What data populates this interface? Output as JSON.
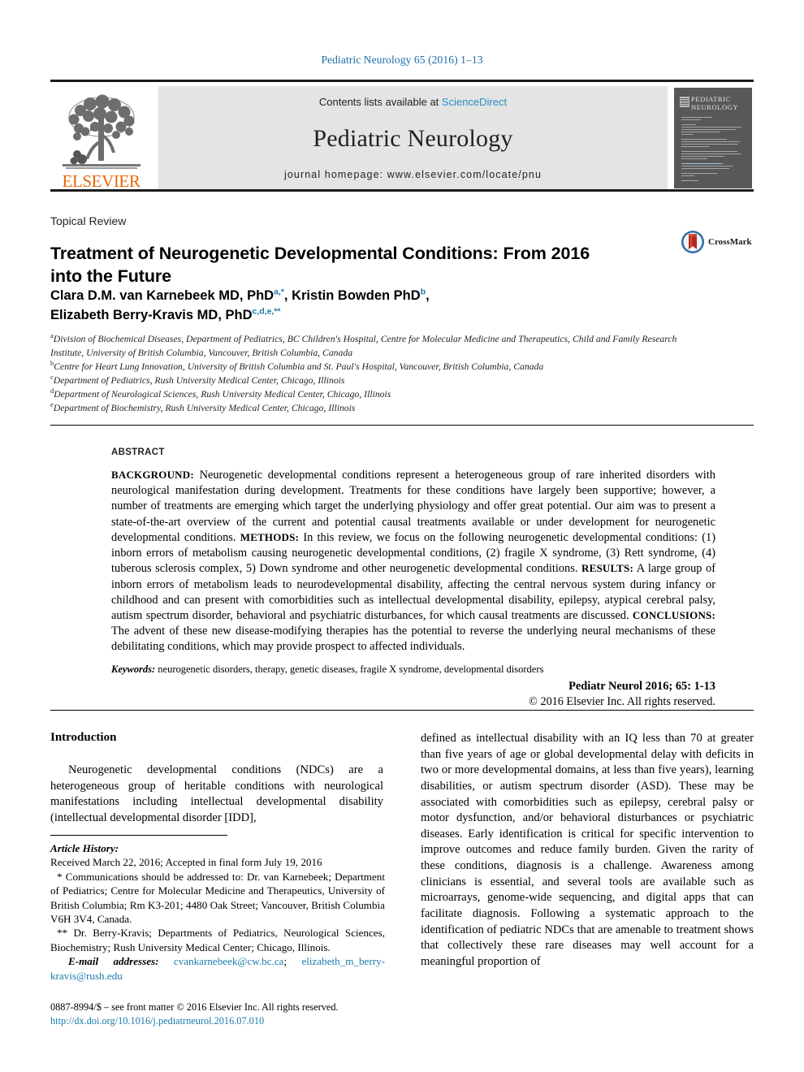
{
  "running_head": "Pediatric Neurology 65 (2016) 1–13",
  "masthead": {
    "contents_prefix": "Contents lists available at ",
    "sciencedirect": "ScienceDirect",
    "journal_name": "Pediatric Neurology",
    "homepage": "journal homepage: www.elsevier.com/locate/pnu",
    "publisher": "ELSEVIER",
    "cover_title_line1": "PEDIATRIC",
    "cover_title_line2": "NEUROLOGY"
  },
  "article": {
    "type_label": "Topical Review",
    "title": "Treatment of Neurogenetic Developmental Conditions: From 2016 into the Future",
    "crossmark_label": "CrossMark",
    "authors_line1_name1": "Clara D.M. van Karnebeek MD, PhD",
    "authors_line1_sup1": "a,*",
    "authors_line1_sep1": ", ",
    "authors_line1_name2": "Kristin Bowden PhD",
    "authors_line1_sup2": "b",
    "authors_line1_end": ",",
    "authors_line2_name": "Elizabeth Berry-Kravis MD, PhD",
    "authors_line2_sup": "c,d,e,**",
    "affiliations": [
      {
        "mark": "a",
        "text": "Division of Biochemical Diseases, Department of Pediatrics, BC Children's Hospital, Centre for Molecular Medicine and Therapeutics, Child and Family Research Institute, University of British Columbia, Vancouver, British Columbia, Canada"
      },
      {
        "mark": "b",
        "text": "Centre for Heart Lung Innovation, University of British Columbia and St. Paul's Hospital, Vancouver, British Columbia, Canada"
      },
      {
        "mark": "c",
        "text": "Department of Pediatrics, Rush University Medical Center, Chicago, Illinois"
      },
      {
        "mark": "d",
        "text": "Department of Neurological Sciences, Rush University Medical Center, Chicago, Illinois"
      },
      {
        "mark": "e",
        "text": "Department of Biochemistry, Rush University Medical Center, Chicago, Illinois"
      }
    ]
  },
  "abstract": {
    "label": "ABSTRACT",
    "sections": [
      {
        "head": "BACKGROUND:",
        "text": " Neurogenetic developmental conditions represent a heterogeneous group of rare inherited disorders with neurological manifestation during development. Treatments for these conditions have largely been supportive; however, a number of treatments are emerging which target the underlying physiology and offer great potential. Our aim was to present a state-of-the-art overview of the current and potential causal treatments available or under development for neurogenetic developmental conditions. "
      },
      {
        "head": "METHODS:",
        "text": " In this review, we focus on the following neurogenetic developmental conditions: (1) inborn errors of metabolism causing neurogenetic developmental conditions, (2) fragile X syndrome, (3) Rett syndrome, (4) tuberous sclerosis complex, 5) Down syndrome and other neurogenetic developmental conditions. "
      },
      {
        "head": "RESULTS:",
        "text": " A large group of inborn errors of metabolism leads to neurodevelopmental disability, affecting the central nervous system during infancy or childhood and can present with comorbidities such as intellectual developmental disability, epilepsy, atypical cerebral palsy, autism spectrum disorder, behavioral and psychiatric disturbances, for which causal treatments are discussed. "
      },
      {
        "head": "CONCLUSIONS:",
        "text": " The advent of these new disease-modifying therapies has the potential to reverse the underlying neural mechanisms of these debilitating conditions, which may provide prospect to affected individuals."
      }
    ],
    "keywords_label": "Keywords:",
    "keywords_text": " neurogenetic disorders, therapy, genetic diseases, fragile X syndrome, developmental disorders",
    "citation": "Pediatr Neurol 2016; 65: 1-13",
    "copyright": "© 2016 Elsevier Inc. All rights reserved."
  },
  "body": {
    "left_heading": "Introduction",
    "left_para": "Neurogenetic developmental conditions (NDCs) are a heterogeneous group of heritable conditions with neurological manifestations including intellectual developmental disability (intellectual developmental disorder [IDD],",
    "right_para": "defined as intellectual disability with an IQ less than 70 at greater than five years of age or global developmental delay with deficits in two or more developmental domains, at less than five years), learning disabilities, or autism spectrum disorder (ASD). These may be associated with comorbidities such as epilepsy, cerebral palsy or motor dysfunction, and/or behavioral disturbances or psychiatric diseases. Early identification is critical for specific intervention to improve outcomes and reduce family burden. Given the rarity of these conditions, diagnosis is a challenge. Awareness among clinicians is essential, and several tools are available such as microarrays, genome-wide sequencing, and digital apps that can facilitate diagnosis. Following a systematic approach to the identification of pediatric NDCs that are amenable to treatment shows that collectively these rare diseases may well account for a meaningful proportion of"
  },
  "footnotes": {
    "article_history_label": "Article History:",
    "article_history": "Received March 22, 2016; Accepted in final form July 19, 2016",
    "corresponding_1": "* Communications should be addressed to: Dr. van Karnebeek; Department of Pediatrics; Centre for Molecular Medicine and Therapeutics, University of British Columbia; Rm K3-201; 4480 Oak Street; Vancouver, British Columbia V6H 3V4, Canada.",
    "corresponding_2": "** Dr. Berry-Kravis; Departments of Pediatrics, Neurological Sciences, Biochemistry; Rush University Medical Center; Chicago, Illinois.",
    "email_label": "E-mail addresses:",
    "email_1": "cvankarnebeek@cw.bc.ca",
    "email_sep": "; ",
    "email_2": "elizabeth_m_berry-kravis@rush.edu",
    "issn": "0887-8994/$ – see front matter © 2016 Elsevier Inc. All rights reserved.",
    "doi": "http://dx.doi.org/10.1016/j.pediatrneurol.2016.07.010"
  },
  "colors": {
    "link": "#1a7aae",
    "elsevier_orange": "#eb6608",
    "sciencedirect_blue": "#2b8dc6",
    "masthead_gray": "#e4e4e4",
    "cover_gray": "#585858"
  }
}
